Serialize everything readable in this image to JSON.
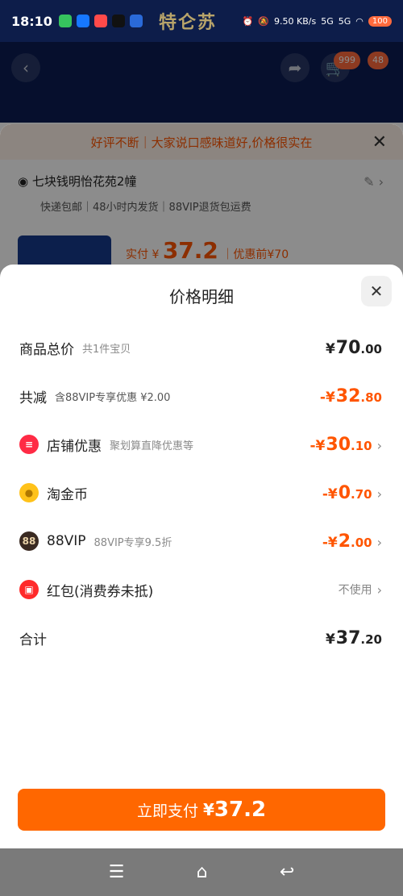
{
  "status_bar": {
    "time": "18:10",
    "brand": "特仑苏",
    "net_speed": "9.50 KB/s",
    "net1": "5G",
    "net2": "5G",
    "battery": "100"
  },
  "background": {
    "tag1": "999",
    "tag2": "48"
  },
  "order_sheet": {
    "promo": "好评不断｜大家说口感味道好,价格很实在",
    "address": "七块钱明怡花苑2幢",
    "shipping": "快递包邮｜48小时内发货｜88VIP退货包运费",
    "pay_prefix": "实付",
    "pay_yen": "¥",
    "pay_amount": "37.2",
    "pay_before": "｜优惠前¥70"
  },
  "price_detail": {
    "title": "价格明细",
    "rows": [
      {
        "label": "商品总价",
        "sub": "共1件宝贝",
        "yen": "¥",
        "main": "70",
        "cents": ".00"
      },
      {
        "label": "共减",
        "sub": "含88VIP专享优惠 ¥2.00",
        "yen": "-¥",
        "main": "32",
        "cents": ".80"
      },
      {
        "label": "店铺优惠",
        "sub": "聚划算直降优惠等",
        "yen": "-¥",
        "main": "30",
        "cents": ".10"
      },
      {
        "label": "淘金币",
        "sub": "",
        "yen": "-¥",
        "main": "0",
        "cents": ".70"
      },
      {
        "label": "88VIP",
        "sub": "88VIP专享9.5折",
        "yen": "-¥",
        "main": "2",
        "cents": ".00"
      },
      {
        "label": "红包(消费券未抵)",
        "sub": "",
        "value": "不使用"
      },
      {
        "label": "合计",
        "sub": "",
        "yen": "¥",
        "main": "37",
        "cents": ".20"
      }
    ],
    "icons": {
      "store": "88",
      "vip": "88"
    },
    "pay_button": {
      "label": "立即支付",
      "yen": "¥",
      "amount": "37.2"
    }
  },
  "colors": {
    "accent": "#ff5500",
    "button": "#ff6700",
    "header": "#0d1d4a"
  }
}
